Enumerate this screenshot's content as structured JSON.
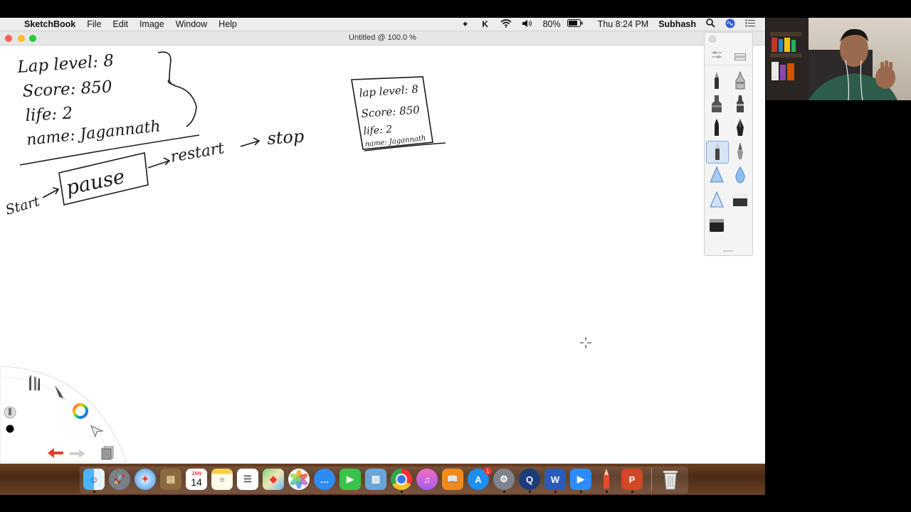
{
  "menubar": {
    "apple_glyph": "",
    "app_name": "SketchBook",
    "menus": [
      "File",
      "Edit",
      "Image",
      "Window",
      "Help"
    ],
    "battery_percent": "80%",
    "clock": "Thu 8:24 PM",
    "user": "Subhash",
    "status_icons": [
      "dropbox-icon",
      "k-icon",
      "wifi-icon",
      "volume-icon",
      "battery-icon",
      "spotlight-icon",
      "siri-icon",
      "notification-center-icon"
    ]
  },
  "window": {
    "title": "Untitled @ 100.0 %"
  },
  "sketch": {
    "lines": [
      "Lap level: 8",
      "Score: 850",
      "life: 2",
      "name: Jagannath"
    ],
    "flow": {
      "start": "Start",
      "pause": "pause",
      "restart": "restart",
      "stop": "stop"
    },
    "box_lines": [
      "lap level: 8",
      "Score: 850",
      "life: 2",
      "name: Jagannath"
    ]
  },
  "palette": {
    "tools": [
      "pencil-icon",
      "ballpoint-pen-icon",
      "marker-icon",
      "felt-pen-icon",
      "paintbrush-icon",
      "ink-pen-icon",
      "pencil-selected-icon",
      "calligraphy-pen-icon",
      "airbrush-icon",
      "water-drop-icon",
      "triangle-airbrush-icon",
      "eraser-icon",
      "hard-eraser-icon"
    ]
  },
  "dock": {
    "apps": [
      "finder-icon",
      "launchpad-icon",
      "safari-icon",
      "contacts-icon",
      "calendar-icon",
      "notes-icon",
      "reminders-icon",
      "maps-icon",
      "photos-icon",
      "messages-icon",
      "facetime-icon",
      "preview-icon",
      "chrome-icon",
      "itunes-icon",
      "books-icon",
      "app-store-icon",
      "system-preferences-icon",
      "quicktime-icon",
      "word-icon",
      "zoom-icon",
      "sketchbook-icon",
      "powerpoint-icon",
      "trash-icon"
    ],
    "calendar_month": "JAN",
    "calendar_day": "14",
    "word_letter": "W",
    "ppt_letter": "P",
    "appstore_badge": "1"
  },
  "colors": {
    "menubar_bg": "#ececec",
    "canvas_bg": "#ffffff",
    "ink": "#1a1a1a",
    "close": "#fc5f57",
    "minimize": "#fdbc2e",
    "zoom": "#28c840"
  }
}
